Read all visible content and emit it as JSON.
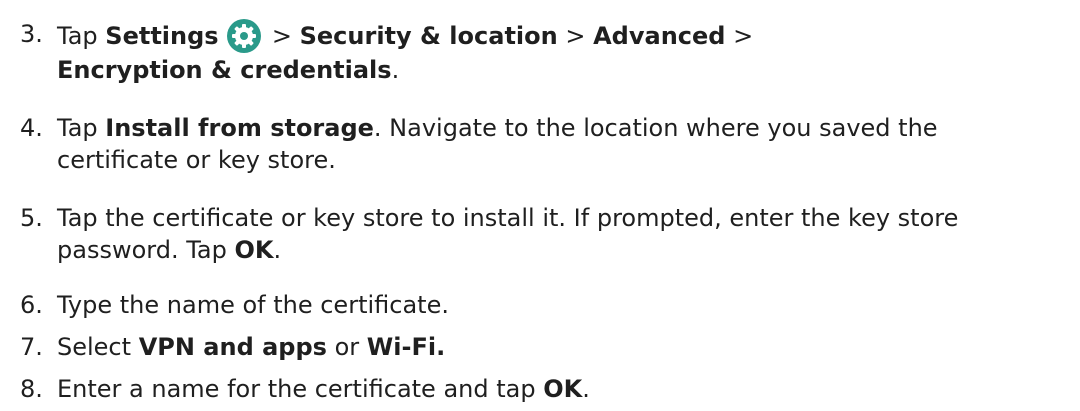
{
  "steps": [
    {
      "number": "3.",
      "tap": "Tap",
      "settings": "Settings",
      "sep1": ">",
      "security": "Security & location",
      "sep2": ">",
      "advanced": "Advanced",
      "sep3": ">",
      "encryption": "Encryption & credentials",
      "end": ".",
      "icon": "settings-gear-icon",
      "icon_color": "#2a9a8a"
    },
    {
      "number": "4.",
      "tap": "Tap",
      "install": "Install from storage",
      "rest_line1": ". Navigate to the location where you saved the",
      "rest_line2": "certificate or key store."
    },
    {
      "number": "5.",
      "line1": "Tap the certificate or key store to install it. If prompted, enter the key store",
      "line2_pre": "password. Tap",
      "ok": "OK",
      "end": "."
    },
    {
      "number": "6.",
      "text": "Type the name of the certificate."
    },
    {
      "number": "7.",
      "select": "Select",
      "vpn": "VPN and apps",
      "or": "or",
      "wifi": "Wi-Fi."
    },
    {
      "number": "8.",
      "pre": "Enter a name for the certificate and tap",
      "ok": "OK",
      "end": "."
    }
  ]
}
